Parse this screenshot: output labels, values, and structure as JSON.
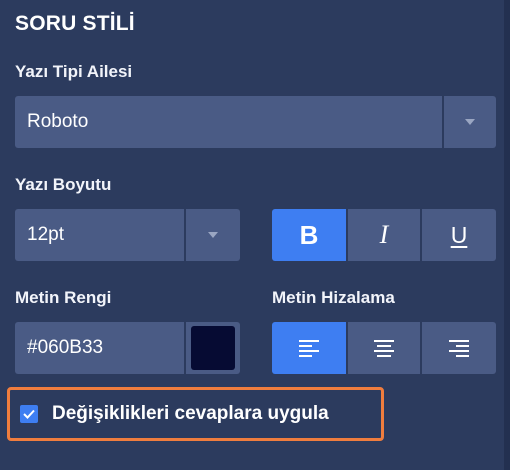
{
  "section": {
    "title": "SORU STİLİ"
  },
  "font_family": {
    "label": "Yazı Tipi Ailesi",
    "value": "Roboto"
  },
  "font_size": {
    "label": "Yazı Boyutu",
    "value": "12pt"
  },
  "style_buttons": {
    "bold": "B",
    "italic": "I",
    "underline": "U",
    "bold_active": true
  },
  "text_color": {
    "label": "Metin Rengi",
    "value": "#060B33",
    "swatch": "#060B33"
  },
  "text_align": {
    "label": "Metin Hizalama",
    "active": "left"
  },
  "apply_option": {
    "label": "Değişiklikleri cevaplara uygula",
    "checked": true
  },
  "colors": {
    "panel": "#2c3b5e",
    "control": "#4a5b85",
    "accent": "#3e7ef2",
    "highlight_border": "#f07d3e"
  }
}
